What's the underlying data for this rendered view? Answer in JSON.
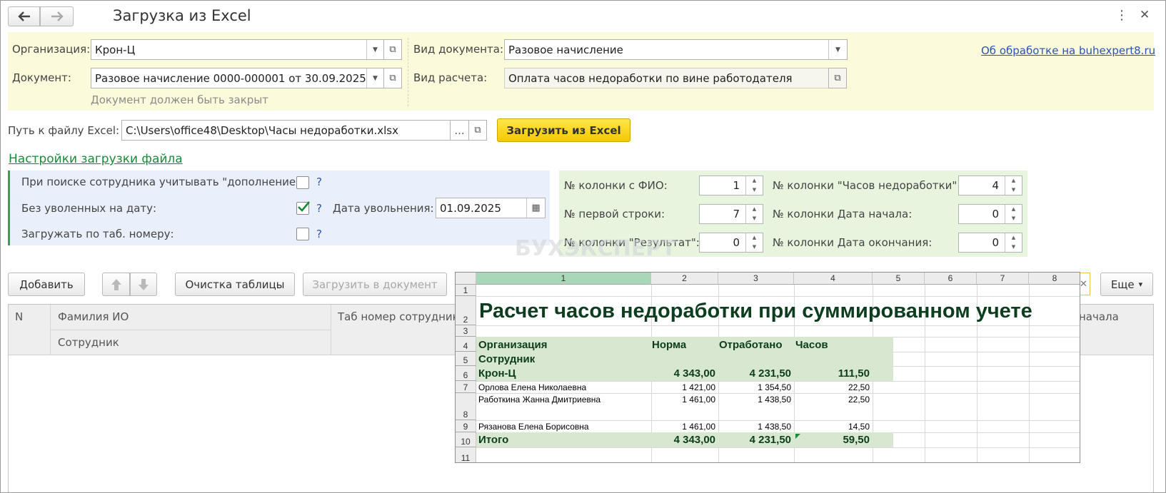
{
  "window": {
    "title": "Загрузка из Excel",
    "more_icon": "⋮",
    "close_icon": "✕"
  },
  "header": {
    "org_label": "Организация:",
    "org_value": "Крон-Ц",
    "doc_label": "Документ:",
    "doc_value": "Разовое начисление 0000-000001 от 30.09.2025",
    "doc_hint": "Документ должен быть закрыт",
    "doctype_label": "Вид документа:",
    "doctype_value": "Разовое начисление",
    "calc_label": "Вид расчета:",
    "calc_value": "Оплата часов недоработки по вине работодателя",
    "about_link": "Об обработке на buhexpert8.ru"
  },
  "file": {
    "label": "Путь к файлу Excel:",
    "value": "C:\\Users\\office48\\Desktop\\Часы недоработки.xlsx",
    "browse": "...",
    "load_button": "Загрузить из Excel"
  },
  "settings": {
    "title": "Настройки загрузки файла",
    "opt1": "При поиске сотрудника учитывать \"дополнение\":",
    "opt2": "Без уволенных на дату:",
    "opt3": "Загружать по таб. номеру:",
    "help": "?",
    "dismiss_label": "Дата увольнения:",
    "dismiss_value": "01.09.2025",
    "opt1_checked": false,
    "opt2_checked": true,
    "opt3_checked": false
  },
  "columns": {
    "fio_label": "№ колонки с ФИО:",
    "fio_value": "1",
    "first_row_label": "№ первой строки:",
    "first_row_value": "7",
    "result_label": "№ колонки \"Результат\":",
    "result_value": "0",
    "hours_label": "№ колонки \"Часов недоработки\":",
    "hours_value": "4",
    "start_label": "№ колонки Дата начала:",
    "start_value": "0",
    "end_label": "№ колонки Дата окончания:",
    "end_value": "0"
  },
  "toolbar": {
    "add": "Добавить",
    "clear": "Очистка таблицы",
    "load_doc": "Загрузить в документ",
    "more": "Еще",
    "more_arrow": "▾"
  },
  "table": {
    "col_n": "N",
    "col_fio": "Фамилия ИО",
    "col_employee": "Сотрудник",
    "col_tab": "Таб номер сотрудника",
    "col_start_partial": "начала"
  },
  "watermark": "БУХЭКСПЕРТ",
  "excel": {
    "col_headers": [
      "1",
      "2",
      "3",
      "4",
      "5",
      "6",
      "7",
      "8"
    ],
    "row_headers": [
      "1",
      "2",
      "3",
      "4",
      "5",
      "6",
      "7",
      "8",
      "9",
      "10",
      "11"
    ],
    "title": "Расчет часов недоработки при суммированном учете",
    "h_org": "Организация",
    "h_emp": "Сотрудник",
    "h_norm": "Норма",
    "h_worked": "Отработано",
    "h_hours": "Часов",
    "rows": [
      {
        "name": "Крон-Ц",
        "norm": "4 343,00",
        "worked": "4 231,50",
        "hours": "111,50"
      },
      {
        "name": "Орлова Елена Николаевна",
        "norm": "1 421,00",
        "worked": "1 354,50",
        "hours": "22,50"
      },
      {
        "name": "Работкина Жанна Дмитриевна",
        "norm": "1 461,00",
        "worked": "1 438,50",
        "hours": "22,50"
      },
      {
        "name": "Рязанова Елена Борисовна",
        "norm": "1 461,00",
        "worked": "1 438,50",
        "hours": "14,50"
      },
      {
        "name": "Итого",
        "norm": "4 343,00",
        "worked": "4 231,50",
        "hours": "59,50"
      }
    ]
  }
}
